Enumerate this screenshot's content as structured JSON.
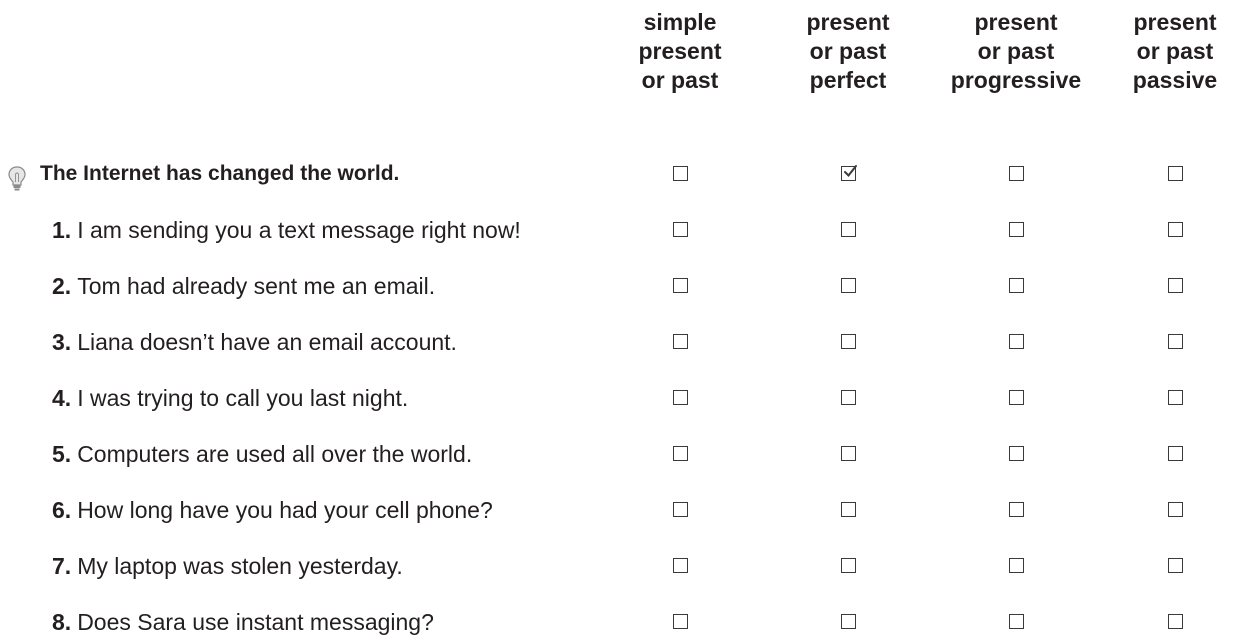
{
  "columns": [
    {
      "label": "simple\npresent\nor past"
    },
    {
      "label": "present\nor past\nperfect"
    },
    {
      "label": "present\nor past\nprogressive"
    },
    {
      "label": "present\nor past\npassive"
    }
  ],
  "example": {
    "icon": "lightbulb-icon",
    "text": "The Internet has changed the world.",
    "checked": [
      false,
      true,
      false,
      false
    ]
  },
  "items": [
    {
      "num": "1.",
      "text": "I am sending you a text message right now!",
      "checked": [
        false,
        false,
        false,
        false
      ]
    },
    {
      "num": "2.",
      "text": "Tom had already sent me an email.",
      "checked": [
        false,
        false,
        false,
        false
      ]
    },
    {
      "num": "3.",
      "text": "Liana doesn’t have an email account.",
      "checked": [
        false,
        false,
        false,
        false
      ]
    },
    {
      "num": "4.",
      "text": "I was trying to call you last night.",
      "checked": [
        false,
        false,
        false,
        false
      ]
    },
    {
      "num": "5.",
      "text": "Computers are used all over the world.",
      "checked": [
        false,
        false,
        false,
        false
      ]
    },
    {
      "num": "6.",
      "text": "How long have you had your cell phone?",
      "checked": [
        false,
        false,
        false,
        false
      ]
    },
    {
      "num": "7.",
      "text": "My laptop was stolen yesterday.",
      "checked": [
        false,
        false,
        false,
        false
      ]
    },
    {
      "num": "8.",
      "text": "Does Sara use instant messaging?",
      "checked": [
        false,
        false,
        false,
        false
      ]
    }
  ]
}
